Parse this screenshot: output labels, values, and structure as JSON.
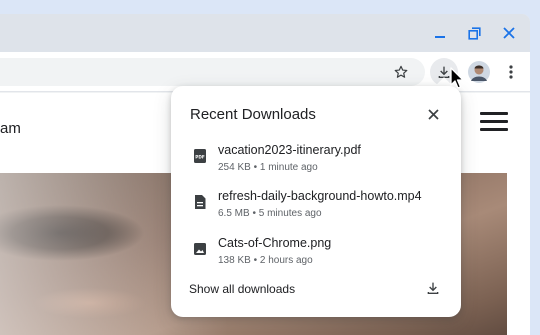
{
  "colors": {
    "background": "#dbe6f7",
    "titlebar": "#dee3ea",
    "accent_icon": "#1a73e8",
    "text_primary": "#202124",
    "text_secondary": "#5f6368"
  },
  "window_controls": {
    "minimize_icon": "minimize-icon",
    "restore_icon": "restore-icon",
    "close_icon": "close-icon"
  },
  "toolbar": {
    "bookmark_icon": "star-icon",
    "downloads_icon": "download-icon",
    "profile_icon": "avatar",
    "menu_icon": "more-vert-icon"
  },
  "page": {
    "partial_text": "am",
    "menu_icon": "hamburger-icon"
  },
  "downloads": {
    "title": "Recent Downloads",
    "close_icon": "close-icon",
    "items": [
      {
        "name": "vacation2023-itinerary.pdf",
        "meta": "254 KB • 1 minute ago",
        "icon": "pdf-icon"
      },
      {
        "name": "refresh-daily-background-howto.mp4",
        "meta": "6.5 MB • 5 minutes ago",
        "icon": "file-icon"
      },
      {
        "name": "Cats-of-Chrome.png",
        "meta": "138 KB • 2 hours ago",
        "icon": "image-icon"
      }
    ],
    "show_all_label": "Show all downloads",
    "show_all_icon": "download-icon"
  }
}
